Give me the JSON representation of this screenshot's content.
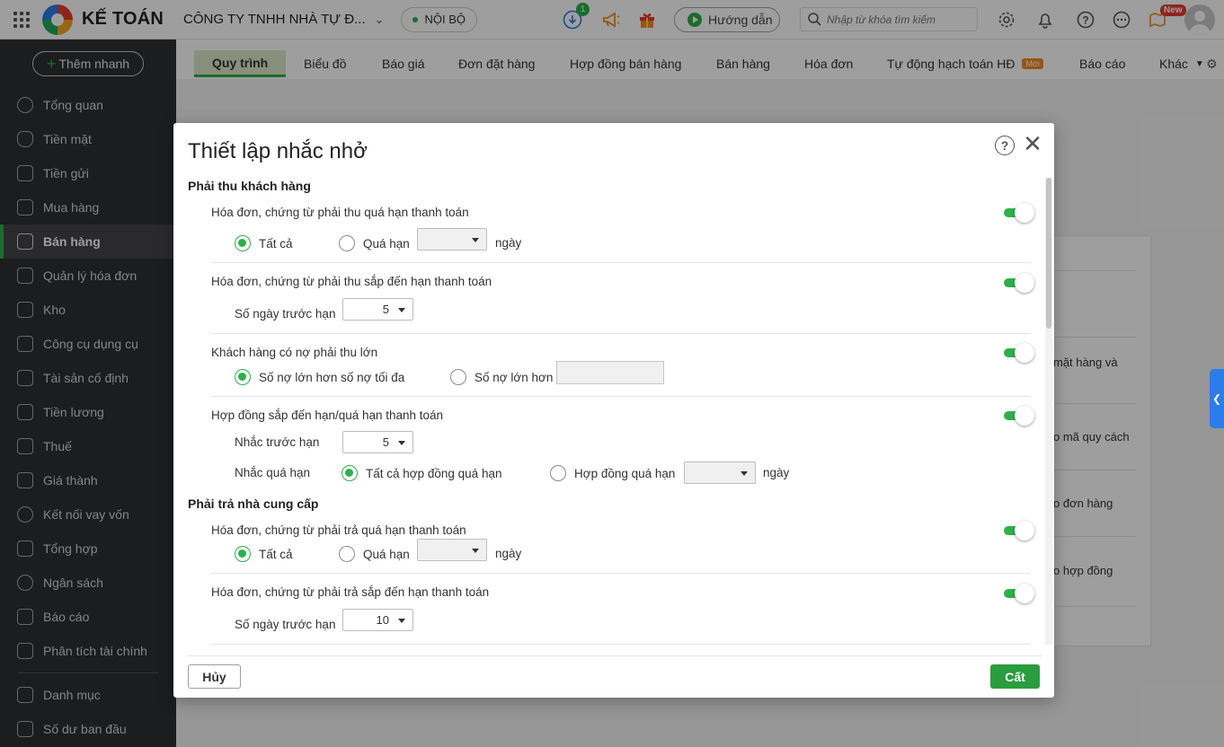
{
  "topbar": {
    "brand": "KẾ TOÁN",
    "company": "CÔNG TY TNHH NHÀ TỰ Đ...",
    "scope": "NỘI BỘ",
    "download_badge": "1",
    "guide_label": "Hướng dẫn",
    "search_placeholder": "Nhập từ khóa tìm kiếm",
    "new_badge": "New"
  },
  "sidebar": {
    "quick_add": "Thêm nhanh",
    "items": [
      {
        "label": "Tổng quan",
        "icon": "pie-chart-icon"
      },
      {
        "label": "Tiền mặt",
        "icon": "money-bag-icon"
      },
      {
        "label": "Tiền gửi",
        "icon": "bank-icon"
      },
      {
        "label": "Mua hàng",
        "icon": "shopping-bag-icon"
      },
      {
        "label": "Bán hàng",
        "icon": "cart-icon"
      },
      {
        "label": "Quản lý hóa đơn",
        "icon": "invoice-icon"
      },
      {
        "label": "Kho",
        "icon": "warehouse-icon"
      },
      {
        "label": "Công cụ dụng cụ",
        "icon": "tools-icon"
      },
      {
        "label": "Tài sản cố định",
        "icon": "car-icon"
      },
      {
        "label": "Tiền lương",
        "icon": "payroll-icon"
      },
      {
        "label": "Thuế",
        "icon": "tax-icon"
      },
      {
        "label": "Giá thành",
        "icon": "price-tag-icon"
      },
      {
        "label": "Kết nối vay vốn",
        "icon": "loan-icon"
      },
      {
        "label": "Tổng hợp",
        "icon": "summary-icon"
      },
      {
        "label": "Ngân sách",
        "icon": "budget-icon"
      },
      {
        "label": "Báo cáo",
        "icon": "bar-chart-icon"
      },
      {
        "label": "Phân tích tài chính",
        "icon": "analysis-icon"
      },
      {
        "label": "Danh mục",
        "icon": "list-icon"
      },
      {
        "label": "Số dư ban đầu",
        "icon": "opening-balance-icon"
      }
    ]
  },
  "tabs": {
    "items": [
      "Quy trình",
      "Biểu đồ",
      "Báo giá",
      "Đơn đặt hàng",
      "Hợp đồng bán hàng",
      "Bán hàng",
      "Hóa đơn",
      "Tự động hạch toán HĐ",
      "Báo cáo",
      "Khác"
    ],
    "moi_badge": "Mới"
  },
  "background_card": {
    "texts": [
      "mặt hàng và",
      "o mã quy cách",
      "o đơn hàng",
      "o hợp đồng"
    ]
  },
  "dialog": {
    "title": "Thiết lập nhắc nhở",
    "section_receivable": "Phải thu khách hàng",
    "section_payable": "Phải trả nhà cung cấp",
    "r1": {
      "title": "Hóa đơn, chứng từ phải thu quá hạn thanh toán",
      "opt_all": "Tất cả",
      "opt_overdue": "Quá hạn",
      "overdue_value": "",
      "unit": "ngày"
    },
    "r2": {
      "title": "Hóa đơn, chứng từ phải thu sắp đến hạn thanh toán",
      "days_label": "Số ngày trước hạn",
      "days_value": "5"
    },
    "r3": {
      "title": "Khách hàng có nợ phải thu lớn",
      "opt_max": "Số nợ lớn hơn số nợ tối đa",
      "opt_greater": "Số nợ lớn hơn",
      "greater_value": ""
    },
    "r4": {
      "title": "Hợp đồng sắp đến hạn/quá hạn thanh toán",
      "before_label": "Nhắc trước hạn",
      "before_value": "5",
      "overdue_label": "Nhắc quá hạn",
      "opt_all_contracts": "Tất cả hợp đồng quá hạn",
      "opt_contract_overdue": "Hợp đồng quá hạn",
      "overdue_value": "",
      "unit": "ngày"
    },
    "p1": {
      "title": "Hóa đơn, chứng từ phải trả quá hạn thanh toán",
      "opt_all": "Tất cả",
      "opt_overdue": "Quá hạn",
      "overdue_value": "",
      "unit": "ngày"
    },
    "p2": {
      "title": "Hóa đơn, chứng từ phải trả sắp đến hạn thanh toán",
      "days_label": "Số ngày trước hạn",
      "days_value": "10"
    },
    "cancel_label": "Hủy",
    "save_label": "Cất"
  },
  "colors": {
    "accent_green": "#2db04a",
    "sidebar_bg": "#2e2f31",
    "save_button": "#2a9d3e",
    "side_handle": "#2b7de9"
  }
}
